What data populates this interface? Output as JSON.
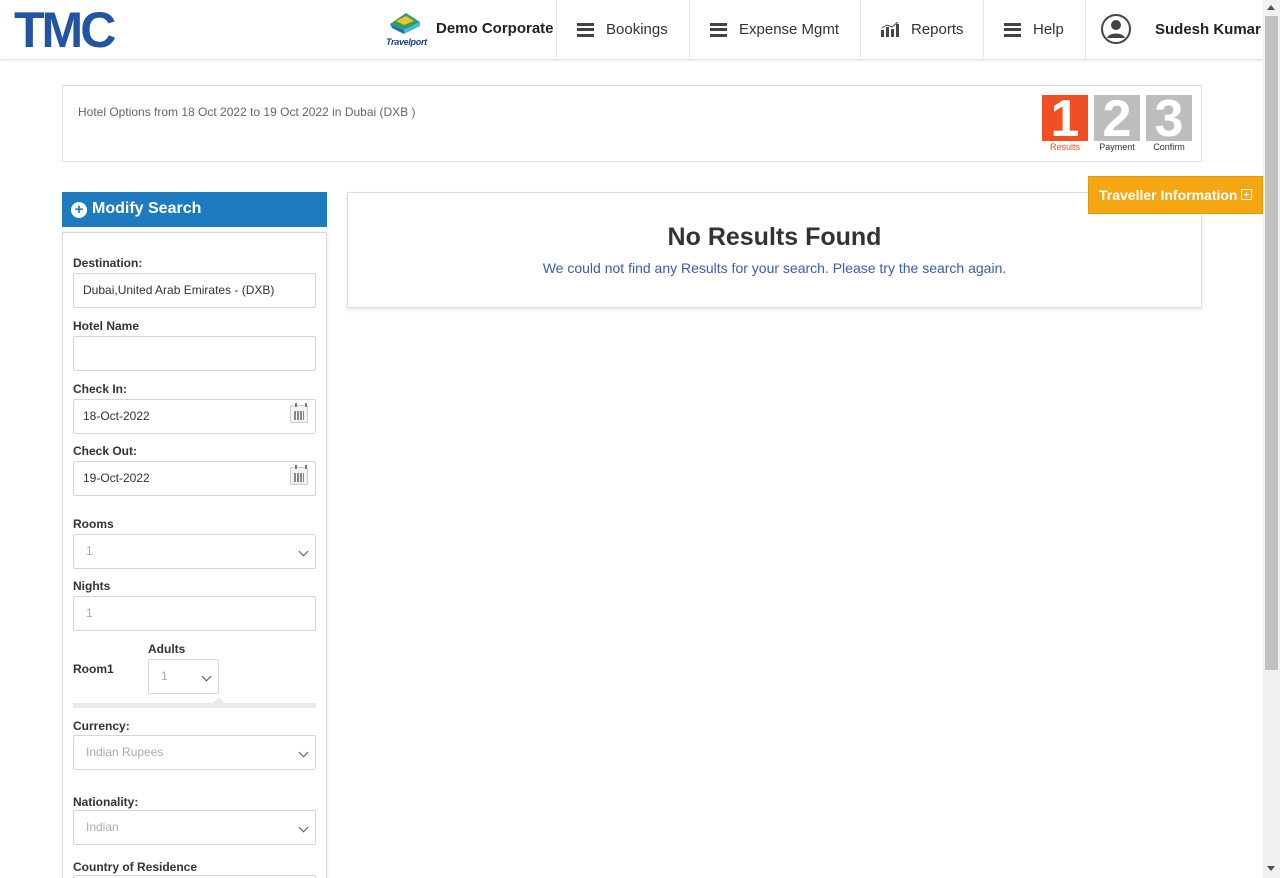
{
  "header": {
    "logo": "TMC",
    "brand_text": "Travelport",
    "company": "Demo Corporate",
    "nav": [
      {
        "label": "Bookings",
        "icon": "menu-icon"
      },
      {
        "label": "Expense Mgmt",
        "icon": "menu-icon"
      },
      {
        "label": "Reports",
        "icon": "bar-chart-icon"
      },
      {
        "label": "Help",
        "icon": "menu-icon"
      }
    ],
    "user_name": "Sudesh Kumar"
  },
  "info": {
    "text": "Hotel Options from  18 Oct 2022 to 19 Oct 2022 in Dubai (DXB )",
    "steps": [
      {
        "num": "1",
        "label": "Results",
        "active": true
      },
      {
        "num": "2",
        "label": "Payment",
        "active": false
      },
      {
        "num": "3",
        "label": "Confirm",
        "active": false
      }
    ]
  },
  "modify": {
    "title": "Modify Search",
    "destination_label": "Destination:",
    "destination_value": "Dubai,United Arab Emirates -  (DXB)",
    "hotel_label": "Hotel Name",
    "hotel_value": "",
    "checkin_label": "Check In:",
    "checkin_value": "18-Oct-2022",
    "checkout_label": "Check Out:",
    "checkout_value": "19-Oct-2022",
    "rooms_label": "Rooms",
    "rooms_value": "1",
    "nights_label": "Nights",
    "nights_value": "1",
    "room1_label": "Room1",
    "adults_label": "Adults",
    "adults_value": "1",
    "currency_label": "Currency:",
    "currency_value": "Indian Rupees",
    "nationality_label": "Nationality:",
    "nationality_value": "Indian",
    "residence_label": "Country of Residence"
  },
  "results": {
    "title": "No Results Found",
    "message": "We could not find any Results for your search. Please try the search again."
  },
  "traveller": {
    "label": "Traveller Information"
  },
  "colors": {
    "brand_blue": "#2155a3",
    "header_blue": "#1e7bc0",
    "step_active": "#f04e23",
    "step_inactive": "#bdbdbd",
    "traveller_orange": "#f4a613",
    "link_blue": "#3b5bb5"
  }
}
